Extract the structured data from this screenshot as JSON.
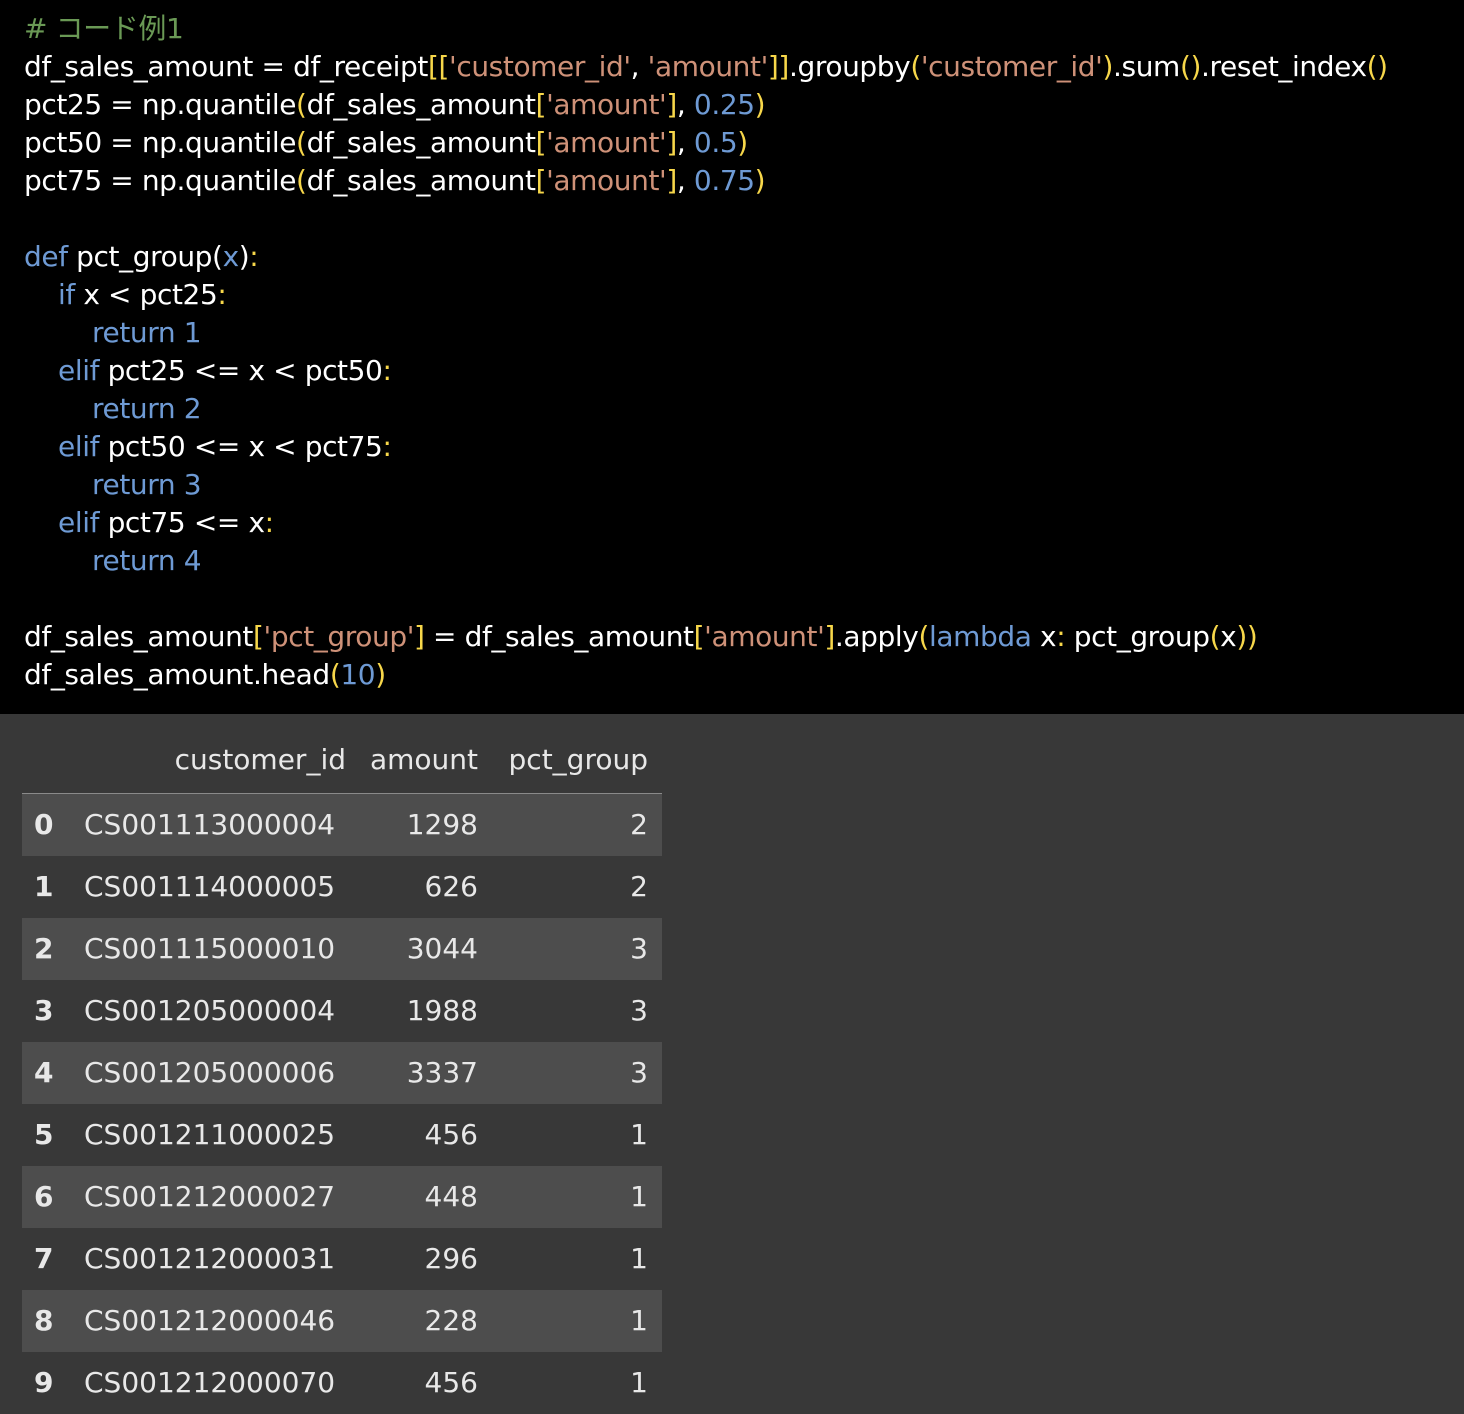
{
  "code": {
    "lines": [
      [
        [
          "comment",
          "# コード例1"
        ]
      ],
      [
        [
          "plain",
          "df_sales_amount = df_receipt"
        ],
        [
          "br",
          "[["
        ],
        [
          "str",
          "'customer_id'"
        ],
        [
          "plain",
          ", "
        ],
        [
          "str",
          "'amount'"
        ],
        [
          "br",
          "]]"
        ],
        [
          "plain",
          ".groupby"
        ],
        [
          "br",
          "("
        ],
        [
          "str",
          "'customer_id'"
        ],
        [
          "br",
          ")"
        ],
        [
          "plain",
          ".sum"
        ],
        [
          "br",
          "()"
        ],
        [
          "plain",
          ".reset_index"
        ],
        [
          "br",
          "()"
        ]
      ],
      [
        [
          "plain",
          "pct25 = np.quantile"
        ],
        [
          "br",
          "("
        ],
        [
          "plain",
          "df_sales_amount"
        ],
        [
          "br",
          "["
        ],
        [
          "str",
          "'amount'"
        ],
        [
          "br",
          "]"
        ],
        [
          "plain",
          ", "
        ],
        [
          "num",
          "0.25"
        ],
        [
          "br",
          ")"
        ]
      ],
      [
        [
          "plain",
          "pct50 = np.quantile"
        ],
        [
          "br",
          "("
        ],
        [
          "plain",
          "df_sales_amount"
        ],
        [
          "br",
          "["
        ],
        [
          "str",
          "'amount'"
        ],
        [
          "br",
          "]"
        ],
        [
          "plain",
          ", "
        ],
        [
          "num",
          "0.5"
        ],
        [
          "br",
          ")"
        ]
      ],
      [
        [
          "plain",
          "pct75 = np.quantile"
        ],
        [
          "br",
          "("
        ],
        [
          "plain",
          "df_sales_amount"
        ],
        [
          "br",
          "["
        ],
        [
          "str",
          "'amount'"
        ],
        [
          "br",
          "]"
        ],
        [
          "plain",
          ", "
        ],
        [
          "num",
          "0.75"
        ],
        [
          "br",
          ")"
        ]
      ],
      [],
      [
        [
          "kw",
          "def"
        ],
        [
          "plain",
          " pct_group("
        ],
        [
          "kw",
          "x"
        ],
        [
          "plain",
          ")"
        ],
        [
          "br",
          ":"
        ]
      ],
      [
        [
          "plain",
          "    "
        ],
        [
          "kw",
          "if"
        ],
        [
          "plain",
          " x < pct25"
        ],
        [
          "br",
          ":"
        ]
      ],
      [
        [
          "plain",
          "        "
        ],
        [
          "kw",
          "return"
        ],
        [
          "plain",
          " "
        ],
        [
          "num",
          "1"
        ]
      ],
      [
        [
          "plain",
          "    "
        ],
        [
          "kw",
          "elif"
        ],
        [
          "plain",
          " pct25 <= x < pct50"
        ],
        [
          "br",
          ":"
        ]
      ],
      [
        [
          "plain",
          "        "
        ],
        [
          "kw",
          "return"
        ],
        [
          "plain",
          " "
        ],
        [
          "num",
          "2"
        ]
      ],
      [
        [
          "plain",
          "    "
        ],
        [
          "kw",
          "elif"
        ],
        [
          "plain",
          " pct50 <= x < pct75"
        ],
        [
          "br",
          ":"
        ]
      ],
      [
        [
          "plain",
          "        "
        ],
        [
          "kw",
          "return"
        ],
        [
          "plain",
          " "
        ],
        [
          "num",
          "3"
        ]
      ],
      [
        [
          "plain",
          "    "
        ],
        [
          "kw",
          "elif"
        ],
        [
          "plain",
          " pct75 <= x"
        ],
        [
          "br",
          ":"
        ]
      ],
      [
        [
          "plain",
          "        "
        ],
        [
          "kw",
          "return"
        ],
        [
          "plain",
          " "
        ],
        [
          "num",
          "4"
        ]
      ],
      [],
      [
        [
          "plain",
          "df_sales_amount"
        ],
        [
          "br",
          "["
        ],
        [
          "str",
          "'pct_group'"
        ],
        [
          "br",
          "]"
        ],
        [
          "plain",
          " = df_sales_amount"
        ],
        [
          "br",
          "["
        ],
        [
          "str",
          "'amount'"
        ],
        [
          "br",
          "]"
        ],
        [
          "plain",
          ".apply"
        ],
        [
          "br",
          "("
        ],
        [
          "kw",
          "lambda"
        ],
        [
          "plain",
          " x"
        ],
        [
          "br",
          ":"
        ],
        [
          "plain",
          " pct_group"
        ],
        [
          "br",
          "("
        ],
        [
          "plain",
          "x"
        ],
        [
          "br",
          "))"
        ]
      ],
      [
        [
          "plain",
          "df_sales_amount.head"
        ],
        [
          "br",
          "("
        ],
        [
          "num",
          "10"
        ],
        [
          "br",
          ")"
        ]
      ]
    ]
  },
  "table": {
    "columns": [
      "customer_id",
      "amount",
      "pct_group"
    ],
    "rows": [
      {
        "index": "0",
        "customer_id": "CS001113000004",
        "amount": "1298",
        "pct_group": "2"
      },
      {
        "index": "1",
        "customer_id": "CS001114000005",
        "amount": "626",
        "pct_group": "2"
      },
      {
        "index": "2",
        "customer_id": "CS001115000010",
        "amount": "3044",
        "pct_group": "3"
      },
      {
        "index": "3",
        "customer_id": "CS001205000004",
        "amount": "1988",
        "pct_group": "3"
      },
      {
        "index": "4",
        "customer_id": "CS001205000006",
        "amount": "3337",
        "pct_group": "3"
      },
      {
        "index": "5",
        "customer_id": "CS001211000025",
        "amount": "456",
        "pct_group": "1"
      },
      {
        "index": "6",
        "customer_id": "CS001212000027",
        "amount": "448",
        "pct_group": "1"
      },
      {
        "index": "7",
        "customer_id": "CS001212000031",
        "amount": "296",
        "pct_group": "1"
      },
      {
        "index": "8",
        "customer_id": "CS001212000046",
        "amount": "228",
        "pct_group": "1"
      },
      {
        "index": "9",
        "customer_id": "CS001212000070",
        "amount": "456",
        "pct_group": "1"
      }
    ]
  },
  "colors": {
    "code_bg": "#000000",
    "output_bg": "#383838",
    "stripe": "#4d4d4d",
    "comment": "#6a9955",
    "string": "#ce9178",
    "keyword_number": "#6e9ad4",
    "bracket": "#f7d74a"
  }
}
